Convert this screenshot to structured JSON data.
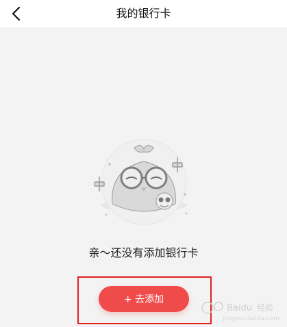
{
  "header": {
    "title": "我的银行卡",
    "back_icon": "back-arrow-icon"
  },
  "empty_state": {
    "message": "亲～还没有添加银行卡",
    "illustration": "owl-mascot-illustration"
  },
  "actions": {
    "add_label": "+ 去添加"
  },
  "watermark": {
    "brand": "Baidu经验",
    "url": "jingyan.baidu.com"
  },
  "colors": {
    "accent": "#ef4b4b",
    "highlight_border": "#e02020",
    "background": "#f3f3f3",
    "header_bg": "#ffffff"
  }
}
